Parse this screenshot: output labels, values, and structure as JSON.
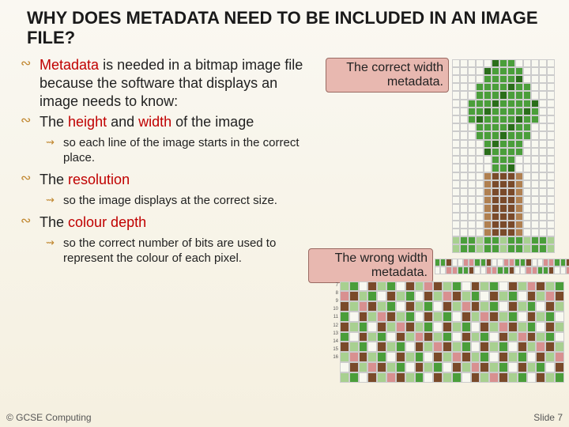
{
  "title": "WHY DOES METADATA NEED TO BE INCLUDED IN AN IMAGE FILE?",
  "bullets": {
    "b1_pre": "Metadata",
    "b1_rest": " is needed in a bitmap image file because the software that displays an image needs to know:",
    "b2_pre": "The ",
    "b2_h": "height",
    "b2_mid": " and ",
    "b2_w": "width",
    "b2_rest": " of the image",
    "b2_sub": "so each line of the image starts in the correct place.",
    "b3_pre": "The ",
    "b3_r": "resolution",
    "b3_sub": "so the image displays at the correct size.",
    "b4_pre": "The ",
    "b4_c": "colour depth",
    "b4_sub": "so the correct number of bits are used to represent the colour of each pixel."
  },
  "callouts": {
    "correct": "The correct width metadata.",
    "wrong": "The wrong width metadata."
  },
  "footer": {
    "left": "© GCSE Computing",
    "right": "Slide 7"
  }
}
